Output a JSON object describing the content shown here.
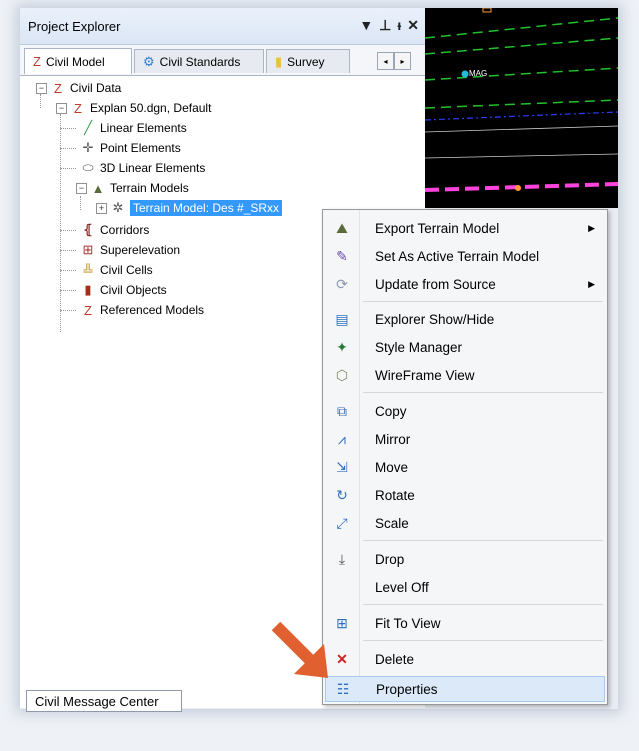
{
  "panel": {
    "title": "Project Explorer",
    "title_icons": [
      "▼",
      "⊥",
      "ᵻ",
      "✕"
    ],
    "tabs": [
      {
        "label": "Civil Model",
        "icon": "Z",
        "active": true
      },
      {
        "label": "Civil Standards",
        "icon": "⚙",
        "active": false
      },
      {
        "label": "Survey",
        "icon": "▮",
        "active": false
      }
    ],
    "tab_scroll": [
      "◂",
      "▸"
    ]
  },
  "tree": {
    "root": "Civil Data",
    "file": "Explan 50.dgn, Default",
    "items": [
      {
        "label": "Linear Elements",
        "icon": "╱"
      },
      {
        "label": "Point Elements",
        "icon": "✛"
      },
      {
        "label": "3D Linear Elements",
        "icon": "⬭"
      },
      {
        "label": "Terrain Models",
        "icon": "▲"
      },
      {
        "label": "Terrain Model: Des #_SRxx",
        "icon": "✲"
      },
      {
        "label": "Corridors",
        "icon": "⦃"
      },
      {
        "label": "Superelevation",
        "icon": "⊞"
      },
      {
        "label": "Civil Cells",
        "icon": "╩"
      },
      {
        "label": "Civil Objects",
        "icon": "▮"
      },
      {
        "label": "Referenced Models",
        "icon": "Z"
      }
    ],
    "expand_minus": "−",
    "expand_plus": "+"
  },
  "bottom_tab": {
    "label": "Civil Message Center"
  },
  "map": {
    "label": "MAG"
  },
  "context_menu": {
    "items": [
      {
        "label": "Export Terrain Model",
        "icon": "⛰",
        "submenu": true
      },
      {
        "label": "Set As Active Terrain Model",
        "icon": "✎",
        "submenu": false
      },
      {
        "label": "Update from Source",
        "icon": "⟳",
        "submenu": true
      },
      {
        "label": "Explorer Show/Hide",
        "icon": "▤",
        "submenu": false
      },
      {
        "label": "Style Manager",
        "icon": "✦",
        "submenu": false
      },
      {
        "label": "WireFrame View",
        "icon": "⬡",
        "submenu": false
      },
      {
        "label": "Copy",
        "icon": "⧉",
        "submenu": false
      },
      {
        "label": "Mirror",
        "icon": "⩘",
        "submenu": false
      },
      {
        "label": "Move",
        "icon": "⇲",
        "submenu": false
      },
      {
        "label": "Rotate",
        "icon": "↻",
        "submenu": false
      },
      {
        "label": "Scale",
        "icon": "⤢",
        "submenu": false
      },
      {
        "label": "Drop",
        "icon": "⤓",
        "submenu": false
      },
      {
        "label": "Level Off",
        "icon": "",
        "submenu": false
      },
      {
        "label": "Fit To View",
        "icon": "⊞",
        "submenu": false
      },
      {
        "label": "Delete",
        "icon": "✕",
        "submenu": false
      },
      {
        "label": "Properties",
        "icon": "☷",
        "submenu": false
      }
    ],
    "submenu_arrow": "▶",
    "highlighted": "Properties"
  },
  "colors": {
    "selection": "#3399ff",
    "menu_highlight": "#dbe9f8",
    "annotation_arrow": "#e06030",
    "delete_red": "#d42020"
  }
}
